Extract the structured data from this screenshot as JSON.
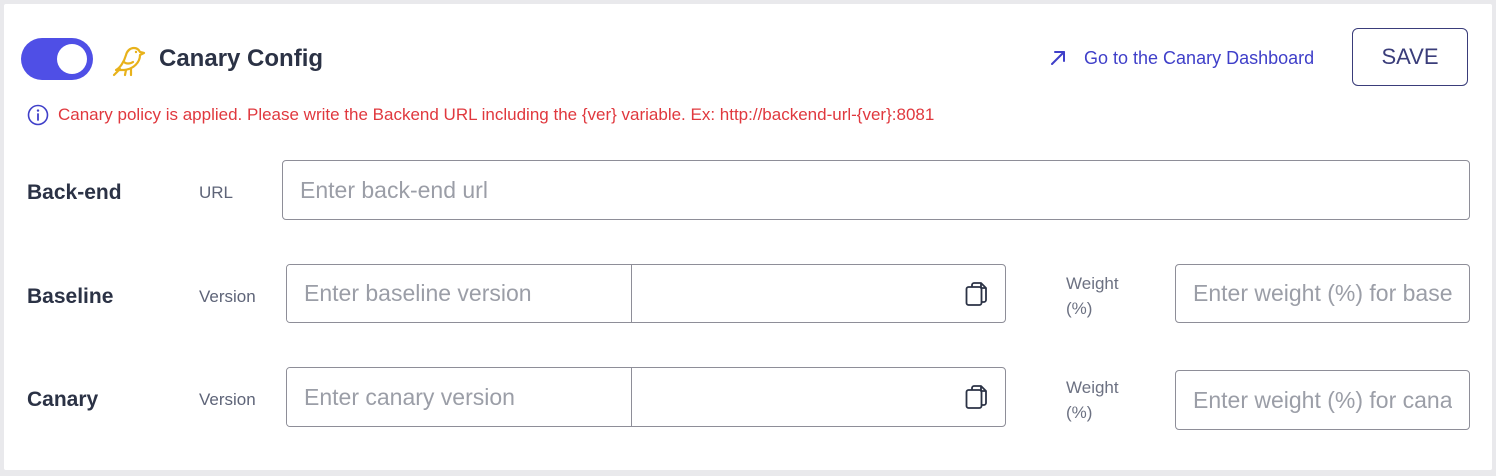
{
  "header": {
    "toggle_on": true,
    "bird_icon": "bird-icon",
    "title": "Canary Config",
    "dashboard_link": "Go to the Canary Dashboard",
    "save_label": "SAVE",
    "accent_color": "#4f4fe6"
  },
  "notice": {
    "icon": "info-icon",
    "text": "Canary policy is applied. Please write the Backend URL including the {ver} variable. Ex: http://backend-url-{ver}:8081",
    "color": "#e0383e"
  },
  "backend": {
    "label": "Back-end",
    "sub_label": "URL",
    "placeholder": "Enter back-end url",
    "value": ""
  },
  "baseline": {
    "label": "Baseline",
    "sub_label": "Version",
    "version_placeholder": "Enter baseline version",
    "weight_label_line1": "Weight",
    "weight_label_line2": "(%)",
    "weight_placeholder": "Enter weight (%) for baseline"
  },
  "canary": {
    "label": "Canary",
    "sub_label": "Version",
    "version_placeholder": "Enter canary version",
    "weight_label_line1": "Weight",
    "weight_label_line2": "(%)",
    "weight_placeholder": "Enter weight (%) for canary"
  }
}
